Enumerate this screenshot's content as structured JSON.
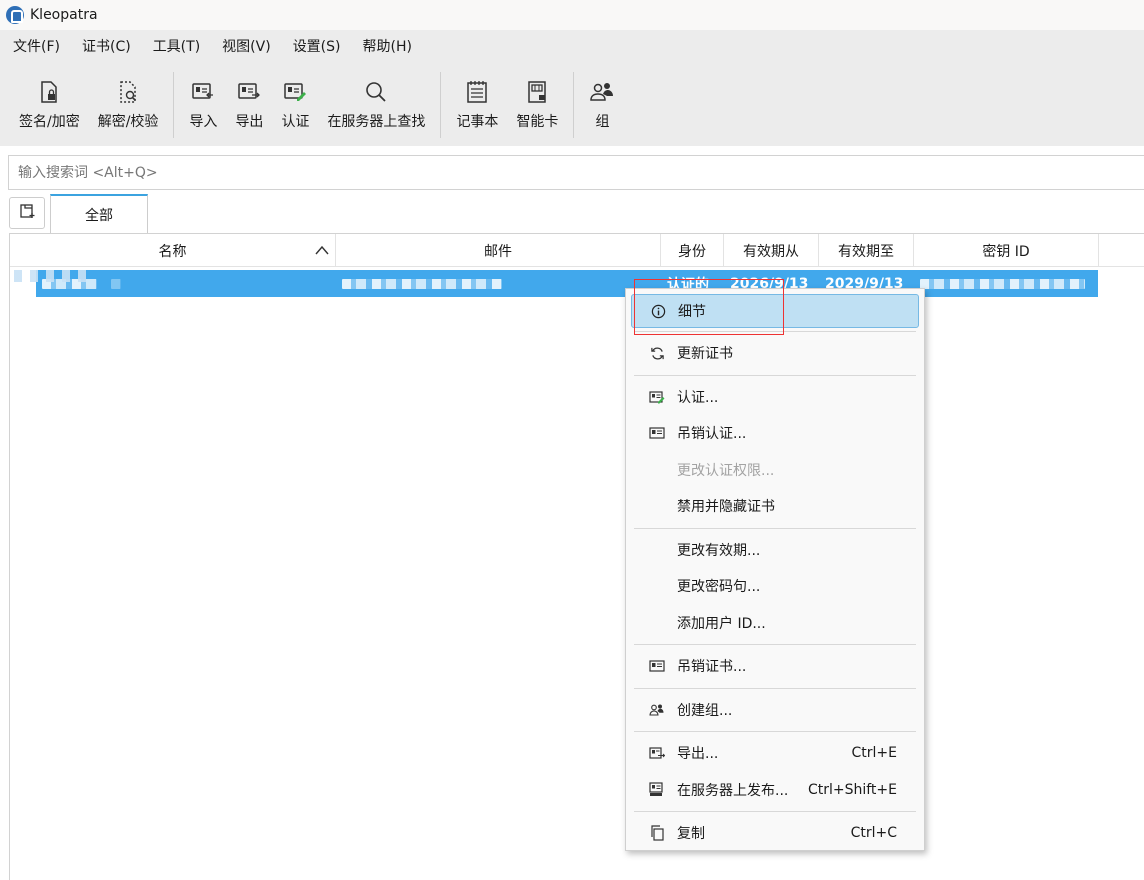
{
  "window": {
    "title": "Kleopatra"
  },
  "menubar": {
    "items": [
      "文件(F)",
      "证书(C)",
      "工具(T)",
      "视图(V)",
      "设置(S)",
      "帮助(H)"
    ]
  },
  "toolbar": {
    "sign_encrypt": "签名/加密",
    "decrypt_verify": "解密/校验",
    "import": "导入",
    "export": "导出",
    "certify": "认证",
    "lookup_server": "在服务器上查找",
    "notepad": "记事本",
    "smartcard": "智能卡",
    "group": "组"
  },
  "search": {
    "placeholder": "输入搜索词 <Alt+Q>"
  },
  "tabs": {
    "all": "全部"
  },
  "table": {
    "headers": {
      "name": "名称",
      "email": "邮件",
      "identity": "身份",
      "valid_from": "有效期从",
      "valid_until": "有效期至",
      "key_id": "密钥 ID"
    },
    "rows": [
      {
        "identity": "认证的",
        "valid_from": "2026/9/13",
        "valid_until": "2029/9/13"
      }
    ]
  },
  "context_menu": {
    "details": "细节",
    "update_cert": "更新证书",
    "certify": "认证...",
    "revoke_certification": "吊销认证...",
    "change_cert_power": "更改认证权限...",
    "disable_hide": "禁用并隐藏证书",
    "change_expiry": "更改有效期...",
    "change_passphrase": "更改密码句...",
    "add_user_id": "添加用户 ID...",
    "revoke_cert": "吊销证书...",
    "create_group": "创建组...",
    "export": "导出...",
    "export_shortcut": "Ctrl+E",
    "publish_server": "在服务器上发布...",
    "publish_shortcut": "Ctrl+Shift+E",
    "copy": "复制",
    "copy_shortcut": "Ctrl+C"
  },
  "colors": {
    "selection": "#41a8ec",
    "highlight": "#bfe0f3",
    "annotation": "#e33333",
    "accent": "#3ba3e0"
  }
}
